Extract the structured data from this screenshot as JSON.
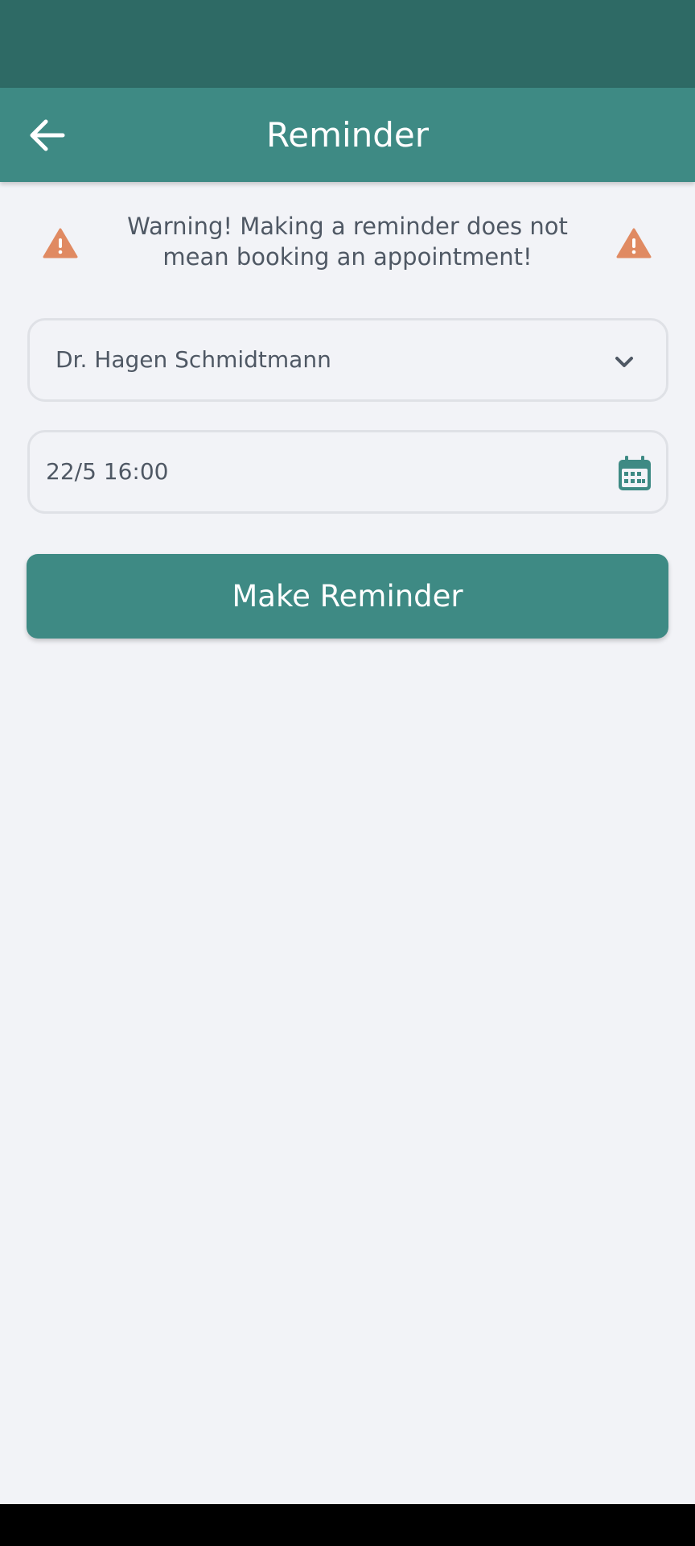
{
  "app_bar": {
    "title": "Reminder",
    "back_icon": "arrow-left-icon"
  },
  "warning": {
    "text": "Warning! Making a reminder does not mean booking an appointment!",
    "icon": "warning-triangle-icon",
    "icon_color": "#e08a62"
  },
  "doctor_select": {
    "selected": "Dr. Hagen Schmidtmann",
    "icon": "chevron-down-icon"
  },
  "datetime_field": {
    "value": "22/5 16:00",
    "icon": "calendar-icon"
  },
  "make_button": {
    "label": "Make Reminder"
  },
  "colors": {
    "status_bar": "#2e6a65",
    "accent": "#3e8a84",
    "background": "#f2f3f7",
    "text": "#4f5864",
    "border": "#dfe1e6"
  }
}
